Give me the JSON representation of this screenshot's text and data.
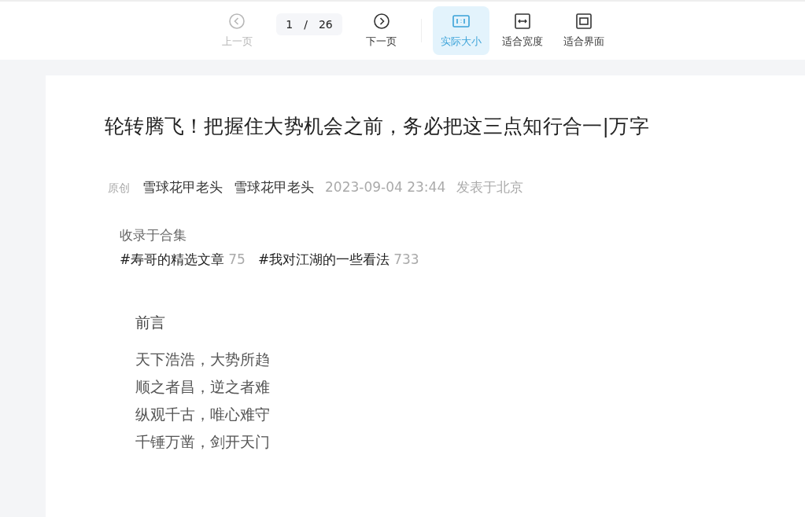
{
  "toolbar": {
    "items": [
      {
        "kind": "previous",
        "label": "上一页",
        "disabled": true,
        "selected": false
      },
      {
        "kind": "pager",
        "current": "1",
        "separator": "/",
        "total": "26"
      },
      {
        "kind": "next",
        "label": "下一页",
        "disabled": false,
        "selected": false
      },
      {
        "kind": "divider"
      },
      {
        "kind": "actual",
        "label": "实际大小",
        "disabled": false,
        "selected": true
      },
      {
        "kind": "width",
        "label": "适合宽度",
        "disabled": false,
        "selected": false
      },
      {
        "kind": "fit",
        "label": "适合界面",
        "disabled": false,
        "selected": false
      }
    ]
  },
  "article": {
    "title": "轮转腾飞！把握住大势机会之前，务必把这三点知行合一|万字",
    "meta": {
      "badge": "原创",
      "authors": [
        "雪球花甲老头",
        "雪球花甲老头"
      ],
      "time": "2023-09-04 23:44",
      "location": "发表于北京"
    },
    "collection": {
      "label": "收录于合集",
      "tags": [
        {
          "name": "#寿哥的精选文章",
          "count": "75"
        },
        {
          "name": "#我对江湖的一些看法",
          "count": "733"
        }
      ]
    },
    "heading": "前言",
    "lines": [
      "天下浩浩，大势所趋",
      "顺之者昌，逆之者难",
      "纵观千古，唯心难守",
      "千锤万凿，剑开天门"
    ]
  }
}
